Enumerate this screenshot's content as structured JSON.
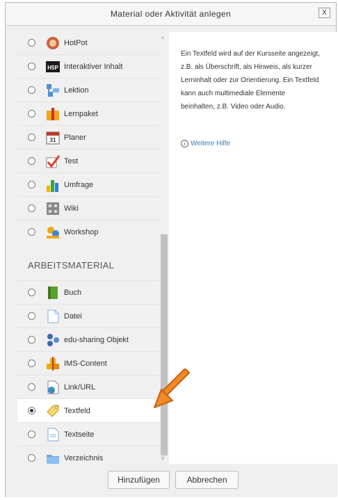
{
  "dialog": {
    "title": "Material oder Aktivität anlegen",
    "close_label": "X"
  },
  "activities": [
    {
      "label": "HotPot",
      "icon": "hotpot-icon"
    },
    {
      "label": "Interaktiver Inhalt",
      "icon": "h5p-icon",
      "badge": "H5P"
    },
    {
      "label": "Lektion",
      "icon": "lesson-icon"
    },
    {
      "label": "Lernpaket",
      "icon": "scorm-package-icon"
    },
    {
      "label": "Planer",
      "icon": "calendar-planner-icon",
      "badge": "31"
    },
    {
      "label": "Test",
      "icon": "quiz-checkmark-icon"
    },
    {
      "label": "Umfrage",
      "icon": "survey-chart-icon"
    },
    {
      "label": "Wiki",
      "icon": "wiki-icon"
    },
    {
      "label": "Workshop",
      "icon": "workshop-icon"
    }
  ],
  "resources_heading": "ARBEITSMATERIAL",
  "resources": [
    {
      "label": "Buch",
      "icon": "book-icon"
    },
    {
      "label": "Datei",
      "icon": "file-icon"
    },
    {
      "label": "edu-sharing Objekt",
      "icon": "edu-sharing-icon"
    },
    {
      "label": "IMS-Content",
      "icon": "ims-content-icon"
    },
    {
      "label": "Link/URL",
      "icon": "link-url-icon"
    },
    {
      "label": "Textfeld",
      "icon": "label-tag-icon",
      "selected": true
    },
    {
      "label": "Textseite",
      "icon": "page-icon"
    },
    {
      "label": "Verzeichnis",
      "icon": "folder-icon"
    }
  ],
  "description": "Ein Textfeld wird auf der Kursseite angezeigt, z.B. als Überschrift, als Hinweis, als kurzer Lerninhalt oder zur Orientierung. Ein Textfeld kann auch multimediale Elemente beinhalten, z.B. Video oder Audio.",
  "help": {
    "icon": "info-icon",
    "label": "Weitere Hilfe"
  },
  "buttons": {
    "add": "Hinzufügen",
    "cancel": "Abbrechen"
  },
  "colors": {
    "selected_row": "#ffffff",
    "link": "#3a7ab8",
    "arrow": "#f08a24"
  }
}
